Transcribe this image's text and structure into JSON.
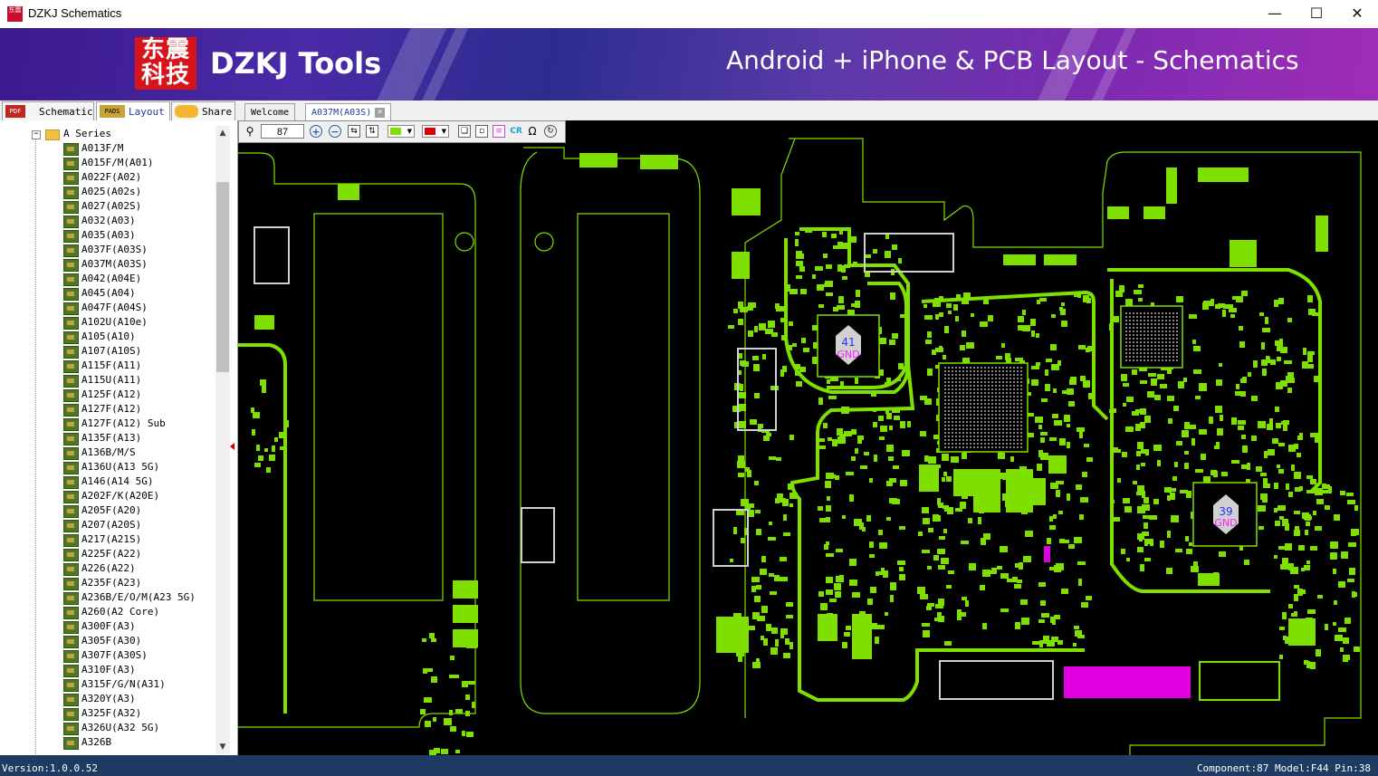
{
  "window": {
    "title": "DZKJ Schematics",
    "icon_text": "东震",
    "controls": [
      "minimize-icon",
      "maximize-icon",
      "close-icon"
    ]
  },
  "banner": {
    "logo_text": "东震科技",
    "brand": "DZKJ Tools",
    "tagline": "Android + iPhone & PCB Layout - Schematics"
  },
  "left_tabs": [
    {
      "label": "Schematic",
      "icon": "PDF",
      "active": false
    },
    {
      "label": "Layout",
      "icon": "PADS",
      "active": true
    },
    {
      "label": "Share",
      "icon": "cloud-icon",
      "active": false
    }
  ],
  "doc_tabs": [
    {
      "label": "Welcome",
      "active": false
    },
    {
      "label": "A037M(A03S)",
      "active": true,
      "close": "×"
    }
  ],
  "toolbar": {
    "zoom_value": "87",
    "zoom_in": "+",
    "zoom_out": "−",
    "color1": "#7fe000",
    "color2": "#e00000",
    "cr_label": "CR",
    "omega_label": "Ω"
  },
  "tree": {
    "root": "A Series",
    "items": [
      "A013F/M",
      "A015F/M(A01)",
      "A022F(A02)",
      "A025(A02s)",
      "A027(A02S)",
      "A032(A03)",
      "A035(A03)",
      "A037F(A03S)",
      "A037M(A03S)",
      "A042(A04E)",
      "A045(A04)",
      "A047F(A04S)",
      "A102U(A10e)",
      "A105(A10)",
      "A107(A10S)",
      "A115F(A11)",
      "A115U(A11)",
      "A125F(A12)",
      "A127F(A12)",
      "A127F(A12) Sub",
      "A135F(A13)",
      "A136B/M/S",
      "A136U(A13 5G)",
      "A146(A14 5G)",
      "A202F/K(A20E)",
      "A205F(A20)",
      "A207(A20S)",
      "A217(A21S)",
      "A225F(A22)",
      "A226(A22)",
      "A235F(A23)",
      "A236B/E/O/M(A23 5G)",
      "A260(A2 Core)",
      "A300F(A3)",
      "A305F(A30)",
      "A307F(A30S)",
      "A310F(A3)",
      "A315F/G/N(A31)",
      "A320Y(A3)",
      "A325F(A32)",
      "A326U(A32 5G)",
      "A326B"
    ]
  },
  "board": {
    "gnd_labels": [
      {
        "num": "41",
        "net": "GND"
      },
      {
        "num": "39",
        "net": "GND"
      }
    ],
    "colors": {
      "outline": "#7fe000",
      "pad": "#7fe000",
      "highlight": "#e000e0",
      "pin": "#3060ff"
    }
  },
  "status": {
    "version": "Version:1.0.0.52",
    "info": "Component:87 Model:F44 Pin:38"
  }
}
